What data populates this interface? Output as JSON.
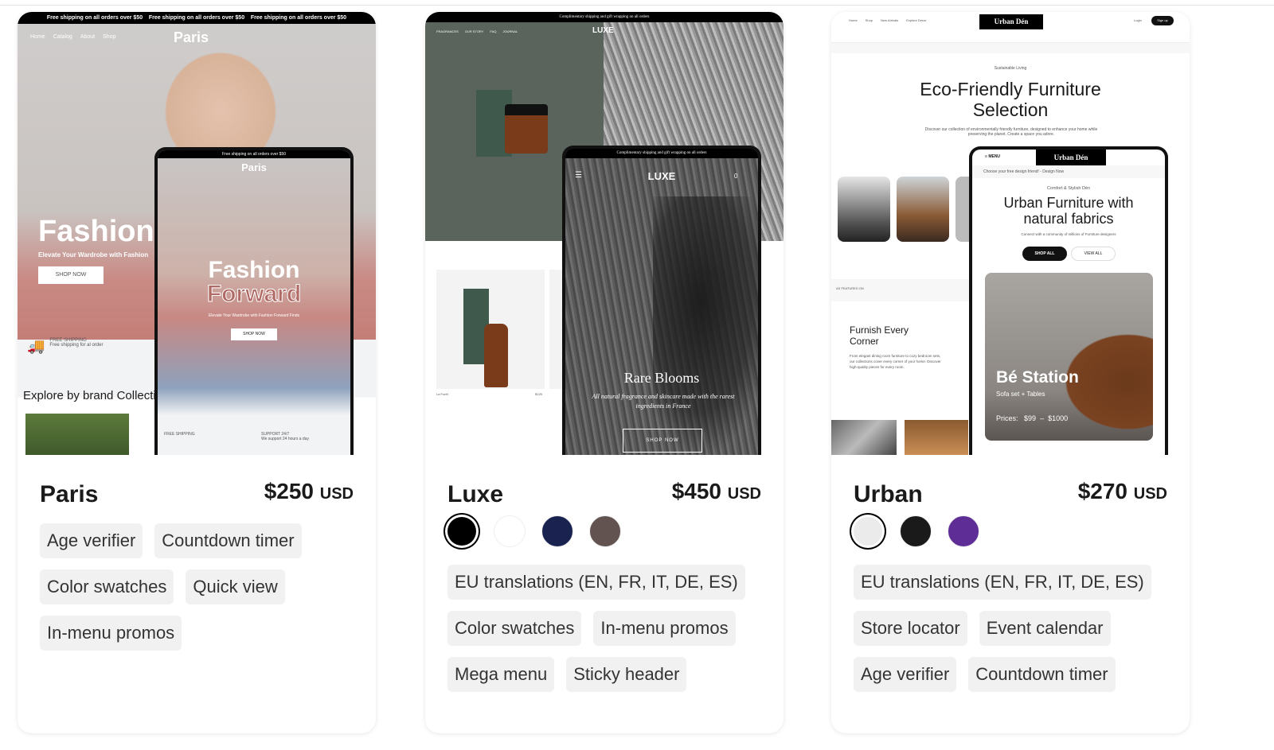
{
  "themes": [
    {
      "name": "Paris",
      "price": "$250",
      "currency": "USD",
      "preview": {
        "announcement": "Free shipping on all orders over $50",
        "nav": [
          "Home",
          "Catalog",
          "About",
          "Shop"
        ],
        "logo": "Paris",
        "hero_title": "Fashion",
        "hero_sub": "Elevate Your Wardrobe with Fashion",
        "cta": "SHOP NOW",
        "feature1_title": "FREE SHIPPING",
        "feature1_text": "Free shipping for al order",
        "feature2_title": "SUPPORT 24/7",
        "feature2_text": "We support 24 hours a day",
        "section_title": "Explore by brand Collection",
        "mobile_title1": "Fashion",
        "mobile_title2": "Forward",
        "mobile_sub": "Elevate Your Wardrobe with Fashion Forward Finds"
      },
      "tags": [
        "Age verifier",
        "Countdown timer",
        "Color swatches",
        "Quick view",
        "In-menu promos"
      ]
    },
    {
      "name": "Luxe",
      "price": "$450",
      "currency": "USD",
      "preview": {
        "announcement": "Complimentary shipping and gift wrapping on all orders",
        "nav": [
          "FRAGRANCES",
          "OUR STORY",
          "FAQ",
          "JOURNAL"
        ],
        "logo": "LUXE",
        "product_name": "La Forêt",
        "product_price": "$125",
        "hero_title": "Rare Blooms",
        "hero_sub": "All natural fragrance and skincare made with the rarest ingredients in France",
        "cta": "SHOP NOW",
        "cart_count": "0"
      },
      "swatches": [
        "#000000",
        "#ffffff",
        "#1a2250",
        "#625350"
      ],
      "tags": [
        "EU translations (EN, FR, IT, DE, ES)",
        "Color swatches",
        "In-menu promos",
        "Mega menu",
        "Sticky header"
      ]
    },
    {
      "name": "Urban",
      "price": "$270",
      "currency": "USD",
      "preview": {
        "nav": [
          "Home",
          "Shop",
          "New Arrivals",
          "Explore Decor"
        ],
        "logo": "Urban Dén",
        "login": "Login",
        "signup": "Sign up",
        "eyebrow": "Sustainable Living",
        "hero_title": "Eco-Friendly Furniture Selection",
        "hero_sub": "Discover our collection of environmentally friendly furniture, designed to enhance your home while preserving the planet. Create a space you adore.",
        "featured_label": "AS FEATURED ON",
        "section_title": "Furnish Every Corner",
        "section_text": "From elegant dining room furniture to cozy bedroom sets, our collections cover every corner of your home. Discover high-quality pieces for every room.",
        "menu": "MENU",
        "mobile_marquee": "Choose your free design friend! - Design Now",
        "mobile_eyebrow": "Comfort & Stylish Dén",
        "mobile_title": "Urban Furniture with natural fabrics",
        "mobile_sub": "Connect with a community of millions of Furniture designers",
        "shop_all": "SHOP ALL",
        "view_all": "VIEW ALL",
        "promo_title": "Bé Station",
        "promo_sub": "Sofa set + Tables",
        "prices_label": "Prices:",
        "price_min": "$99",
        "price_max": "$1000"
      },
      "swatches": [
        "#ebebeb",
        "#1a1a1a",
        "#5f2d96"
      ],
      "tags": [
        "EU translations (EN, FR, IT, DE, ES)",
        "Store locator",
        "Event calendar",
        "Age verifier",
        "Countdown timer"
      ]
    }
  ]
}
